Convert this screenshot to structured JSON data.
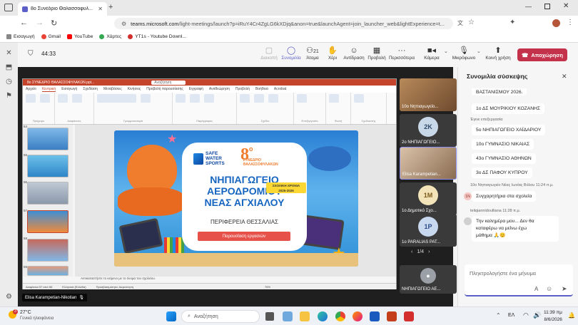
{
  "browser": {
    "tab_title": "8ο Συνέδριο Θαλασσοφυλ...",
    "new_tab": "+",
    "url_host": "teams.microsoft.com",
    "url_path": "/light-meetings/launch?p=iRuY4Cr4ZgLG6kXDjq&anon=true&launchAgent=join_launcher_web&lightExperience=t...",
    "bookmarks": [
      "Εισαγωγή",
      "Gmail",
      "YouTube",
      "Χάρτες",
      "YT1s - Youtube Downl..."
    ]
  },
  "meeting": {
    "timer": "44:33",
    "tools": [
      {
        "label": "Διακοπή",
        "icon": "record-icon"
      },
      {
        "label": "Συνομιλία",
        "icon": "chat-icon"
      },
      {
        "label": "Άτομα",
        "icon": "people-icon",
        "count": "21"
      },
      {
        "label": "Χέρι",
        "icon": "raise-hand-icon"
      },
      {
        "label": "Αντίδραση",
        "icon": "reaction-icon"
      },
      {
        "label": "Προβολή",
        "icon": "view-icon"
      },
      {
        "label": "Περισσότερα",
        "icon": "more-icon"
      },
      {
        "label": "Κάμερα",
        "icon": "camera-off-icon"
      },
      {
        "label": "Μικρόφωνο",
        "icon": "mic-off-icon"
      },
      {
        "label": "Κοινή χρήση",
        "icon": "share-icon"
      }
    ],
    "leave_label": "Αποχώρηση"
  },
  "ppt": {
    "window_title": "8ο ΣΥΝΕΔΡΙΟ ΘΑΛΑΣΣΟΦΥΛΑΚΩΝ.ppt...",
    "search": "Αναζήτηση",
    "menu": [
      "Αρχείο",
      "Κεντρική",
      "Εισαγωγή",
      "Σχεδίαση",
      "Μεταβάσεις",
      "Κινήσεις",
      "Προβολή παρουσίασης",
      "Εγγραφή",
      "Αναθεώρηση",
      "Προβολή",
      "Βοήθεια",
      "Acrobat"
    ],
    "ribbon_groups": [
      "Πρόχειρο",
      "Διαφάνειες",
      "Γραμματοσειρά",
      "Παράγραφος",
      "Σχέδιο",
      "Επεξεργασία",
      "Φωνή",
      "Σχεδιαστής"
    ],
    "slide_numbers": [
      "54",
      "55",
      "56",
      "57",
      "58",
      "59"
    ],
    "notes_placeholder": "Αντικαταστήστε το κείμενο με το όνομα του σχολείου.",
    "status": [
      "Διαφάνεια 57 από 66",
      "Ελληνικά (Ελλάδα)",
      "Προσβασιμότητα: Διερεύνηση",
      "76%"
    ],
    "slide": {
      "brand_line1": "SAFE",
      "brand_line2": "WATER",
      "brand_line3": "SPORTS",
      "conf_number": "8",
      "conf_superscript": "ο",
      "conf_line1": "ΣΥΝΕΔΡΙΟ",
      "conf_line2": "ΘΑΛΑΣΣΟΦΥΛΑΚΩΝ",
      "school_line1": "ΝΗΠΙΑΓΩΓΕΙΟ",
      "school_line2": "ΑΕΡΟΔΡΟΜΙΟΥ",
      "school_line3": "ΝΕΑΣ ΑΓΧΙΑΛΟΥ",
      "year_label": "ΣΧΟΛΙΚΗ ΧΡΟΝΙΑ",
      "year_value": "2025-2026",
      "region": "ΠΕΡΙΦΕΡΕΙΑ ΘΕΣΣΑΛΙΑΣ",
      "presentation": "Παρουσίαση εργασιών"
    },
    "presenter_badge": "Elisa Karampetian-Nikotian"
  },
  "gallery": {
    "tiles": [
      {
        "name": "10ο Νηπιαγωγείο...",
        "initials": "",
        "kind": "video"
      },
      {
        "name": "2ο ΝΗΠΙΑΓΩΓΕΙΟ...",
        "initials": "2K",
        "kind": "avatar",
        "color": "#c8d8e8"
      },
      {
        "name": "Elisa Karampetian...",
        "initials": "",
        "kind": "video"
      },
      {
        "name": "1ο Δημοτικό Σχο...",
        "initials": "1M",
        "kind": "avatar",
        "color": "#f3e3b8"
      },
      {
        "name": "1ο PARALIAS PAT...",
        "initials": "1P",
        "kind": "avatar",
        "color": "#c8d8ee"
      },
      {
        "name": "ΝΗΠΙΑΓΩΓΕΙΟ ΑΕ...",
        "initials": "",
        "kind": "avatar",
        "color": "#9aa0a6"
      }
    ],
    "page": "1/4"
  },
  "chat": {
    "title": "Συνομιλία σύσκεψης",
    "messages_top": [
      "ΒΑΣΤΑΝΙΣΜΟΥ 2026.",
      "1ο ΔΣ ΜΟΥΡΙΚΙΟΥ ΚΟΖΑΝΗΣ"
    ],
    "edited": "Έγινε επεξεργασία",
    "messages_list": [
      "5ο ΝΗΠΙΑΓΩΓΕΙΟ ΧΑΪΔΑΡΙΟΥ",
      "10ο ΓΥΜΝΑΣΙΟ ΝΙΚΑΙΑΣ",
      "43ο ΓΥΜΝΑΣΙΟ ΑΘΗΝΩΝ",
      "3ο ΔΣ ΠΑΦΟΥ ΚΥΠΡΟΥ"
    ],
    "sender1": "10ο Νηπιαγωγείο Νέας Ιωνίας Βόλου",
    "sender1_time": "11:24 π.μ.",
    "sender1_initials": "1Ν",
    "sender1_msg": "Συγχαρητήρια στα σχολεία",
    "sender2": "teliqiannidoulliana",
    "sender2_time": "11:28 π.μ.",
    "sender2_msg1": "Την καλημέρα μου... Δεν θα",
    "sender2_msg2": "καταφέρω να μείνω έχω",
    "sender2_msg3": "μάθημα 🙏😊",
    "composer_placeholder": "Πληκτρολογήστε ένα μήνυμα"
  },
  "taskbar": {
    "weather_temp": "27°C",
    "weather_desc": "Γενικά ηλιοφάνεια",
    "notif_count": "3",
    "search": "Αναζήτηση",
    "lang": "ΕΛ",
    "time": "11:39 πμ",
    "date": "8/6/2026"
  }
}
